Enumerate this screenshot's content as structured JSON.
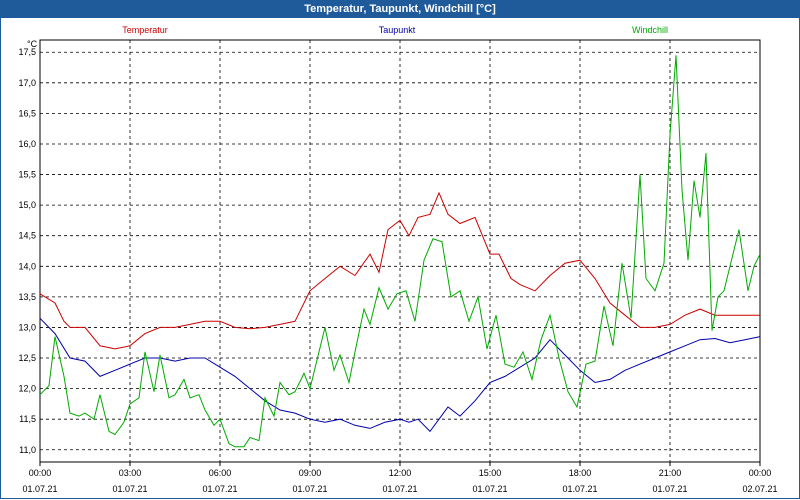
{
  "window": {
    "title": "Temperatur, Taupunkt, Windchill [°C]"
  },
  "chart_data": {
    "type": "line",
    "title": "Temperatur, Taupunkt, Windchill [°C]",
    "ylabel": "°C",
    "ylim": [
      10.8,
      17.7
    ],
    "yticks": [
      "11,0",
      "11,5",
      "12,0",
      "12,5",
      "13,0",
      "13,5",
      "14,0",
      "14,5",
      "15,0",
      "15,5",
      "16,0",
      "16,5",
      "17,0",
      "17,5"
    ],
    "xlim": [
      0,
      24
    ],
    "xticks": [
      {
        "time": "00:00",
        "date": "01.07.21"
      },
      {
        "time": "03:00",
        "date": "01.07.21"
      },
      {
        "time": "06:00",
        "date": "01.07.21"
      },
      {
        "time": "09:00",
        "date": "01.07.21"
      },
      {
        "time": "12:00",
        "date": "01.07.21"
      },
      {
        "time": "15:00",
        "date": "01.07.21"
      },
      {
        "time": "18:00",
        "date": "01.07.21"
      },
      {
        "time": "21:00",
        "date": "01.07.21"
      },
      {
        "time": "00:00",
        "date": "02.07.21"
      }
    ],
    "grid": true,
    "legend_position": "top",
    "x_unit": "hours since 01.07.21 00:00",
    "series": [
      {
        "name": "Temperatur",
        "color": "#cc0000",
        "x": [
          0,
          0.5,
          0.8,
          1.0,
          1.5,
          2.0,
          2.5,
          3.0,
          3.5,
          4.0,
          4.5,
          5.0,
          5.5,
          6.0,
          6.5,
          7.0,
          7.5,
          8.0,
          8.5,
          9.0,
          9.5,
          10.0,
          10.5,
          11.0,
          11.3,
          11.6,
          12.0,
          12.3,
          12.6,
          13.0,
          13.3,
          13.6,
          14.0,
          14.5,
          15.0,
          15.3,
          15.7,
          16.0,
          16.5,
          17.0,
          17.5,
          18.0,
          18.5,
          19.0,
          19.5,
          20.0,
          20.5,
          21.0,
          21.5,
          22.0,
          22.5,
          23.0,
          23.5,
          24.0
        ],
        "y": [
          13.55,
          13.4,
          13.1,
          13.0,
          13.0,
          12.7,
          12.65,
          12.7,
          12.9,
          13.0,
          13.0,
          13.05,
          13.1,
          13.1,
          13.0,
          12.98,
          13.0,
          13.05,
          13.1,
          13.6,
          13.8,
          14.0,
          13.85,
          14.2,
          13.9,
          14.6,
          14.75,
          14.5,
          14.8,
          14.85,
          15.2,
          14.85,
          14.7,
          14.8,
          14.2,
          14.2,
          13.8,
          13.7,
          13.6,
          13.85,
          14.05,
          14.1,
          13.8,
          13.4,
          13.2,
          13.0,
          13.0,
          13.05,
          13.2,
          13.3,
          13.2,
          13.2,
          13.2,
          13.2
        ]
      },
      {
        "name": "Taupunkt",
        "color": "#0000aa",
        "x": [
          0,
          0.5,
          1.0,
          1.5,
          2.0,
          2.5,
          3.0,
          3.5,
          4.0,
          4.5,
          5.0,
          5.5,
          6.0,
          6.5,
          7.0,
          7.5,
          8.0,
          8.5,
          9.0,
          9.5,
          10.0,
          10.5,
          11.0,
          11.5,
          12.0,
          12.3,
          12.6,
          13.0,
          13.3,
          13.6,
          14.0,
          14.5,
          15.0,
          15.5,
          16.0,
          16.5,
          17.0,
          17.5,
          18.0,
          18.5,
          19.0,
          19.5,
          20.0,
          20.5,
          21.0,
          21.5,
          22.0,
          22.5,
          23.0,
          23.5,
          24.0
        ],
        "y": [
          13.15,
          12.9,
          12.5,
          12.45,
          12.2,
          12.3,
          12.4,
          12.5,
          12.5,
          12.45,
          12.5,
          12.5,
          12.35,
          12.2,
          12.0,
          11.8,
          11.65,
          11.6,
          11.5,
          11.45,
          11.5,
          11.4,
          11.35,
          11.45,
          11.5,
          11.45,
          11.5,
          11.3,
          11.5,
          11.7,
          11.55,
          11.8,
          12.1,
          12.2,
          12.35,
          12.5,
          12.8,
          12.55,
          12.3,
          12.1,
          12.15,
          12.3,
          12.4,
          12.5,
          12.6,
          12.7,
          12.8,
          12.82,
          12.75,
          12.8,
          12.85
        ]
      },
      {
        "name": "Windchill",
        "color": "#00aa00",
        "x": [
          0,
          0.3,
          0.5,
          0.8,
          1.0,
          1.3,
          1.5,
          1.8,
          2.0,
          2.3,
          2.5,
          2.8,
          3.0,
          3.3,
          3.5,
          3.8,
          4.0,
          4.3,
          4.5,
          4.8,
          5.0,
          5.3,
          5.5,
          5.8,
          6.0,
          6.3,
          6.5,
          6.8,
          7.0,
          7.3,
          7.5,
          7.8,
          8.0,
          8.3,
          8.5,
          8.8,
          9.0,
          9.3,
          9.5,
          9.8,
          10.0,
          10.3,
          10.5,
          10.8,
          11.0,
          11.3,
          11.6,
          11.9,
          12.2,
          12.5,
          12.8,
          13.1,
          13.4,
          13.7,
          14.0,
          14.3,
          14.6,
          14.9,
          15.2,
          15.5,
          15.8,
          16.1,
          16.4,
          16.7,
          17.0,
          17.3,
          17.6,
          17.9,
          18.2,
          18.5,
          18.8,
          19.1,
          19.4,
          19.7,
          20.0,
          20.2,
          20.5,
          20.8,
          21.0,
          21.2,
          21.4,
          21.6,
          21.8,
          22.0,
          22.2,
          22.4,
          22.6,
          22.8,
          23.0,
          23.3,
          23.6,
          23.8,
          24.0
        ],
        "y": [
          11.9,
          12.05,
          12.85,
          12.2,
          11.6,
          11.55,
          11.6,
          11.5,
          11.9,
          11.3,
          11.25,
          11.45,
          11.75,
          11.85,
          12.6,
          11.95,
          12.55,
          11.85,
          11.9,
          12.15,
          11.85,
          11.9,
          11.65,
          11.4,
          11.5,
          11.1,
          11.05,
          11.05,
          11.2,
          11.15,
          11.85,
          11.55,
          12.1,
          11.9,
          11.95,
          12.25,
          12.0,
          12.6,
          13.0,
          12.3,
          12.55,
          12.1,
          12.6,
          13.3,
          13.05,
          13.65,
          13.3,
          13.55,
          13.6,
          13.1,
          14.1,
          14.45,
          14.4,
          13.5,
          13.6,
          13.1,
          13.5,
          12.65,
          13.2,
          12.4,
          12.35,
          12.6,
          12.15,
          12.8,
          13.2,
          12.5,
          11.95,
          11.7,
          12.4,
          12.45,
          13.35,
          12.7,
          14.05,
          13.15,
          15.5,
          13.8,
          13.6,
          14.05,
          16.15,
          17.45,
          15.25,
          14.1,
          15.4,
          14.8,
          15.85,
          12.95,
          13.5,
          13.6,
          14.0,
          14.6,
          13.6,
          14.0,
          14.2
        ]
      }
    ]
  }
}
